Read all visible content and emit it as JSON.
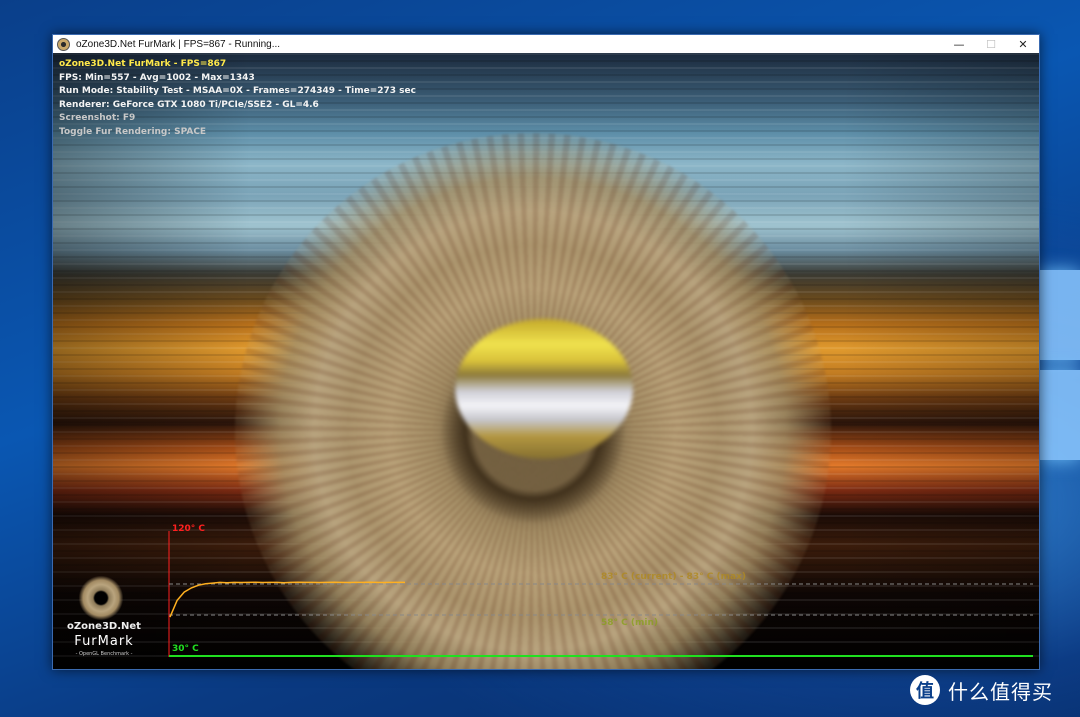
{
  "window": {
    "title": "oZone3D.Net FurMark | FPS=867 - Running...",
    "controls": {
      "minimize": "—",
      "maximize": "☐",
      "close": "✕"
    }
  },
  "osd": {
    "line1": "oZone3D.Net FurMark - FPS=867",
    "line2": "FPS: Min=557 - Avg=1002 - Max=1343",
    "line3": "Run Mode: Stability Test - MSAA=0X - Frames=274349 - Time=273 sec",
    "line4": "Renderer: GeForce GTX 1080 Ti/PCIe/SSE2 - GL=4.6",
    "line5": "Screenshot: F9",
    "line6": "Toggle Fur Rendering: SPACE"
  },
  "logo": {
    "site": "oZone3D.Net",
    "product": "FurMark",
    "tagline": "- OpenGL Benchmark -"
  },
  "temperature_graph": {
    "top_label": "120° C",
    "bottom_label": "30° C",
    "cur_label": "83° C (current) - 83° C (max)",
    "mid_label": "58° C (min)",
    "colors": {
      "axis_top": "#ff2020",
      "axis_bottom": "#20e020",
      "curve": "#ffb020",
      "dashed": "#888888"
    }
  },
  "chart_data": {
    "type": "line",
    "ylim": [
      30,
      120
    ],
    "series": [
      {
        "values": [
          58,
          70,
          76,
          79,
          81,
          82,
          82.5,
          83,
          82.8,
          83,
          82.9,
          83,
          83.1,
          82.9,
          83,
          83,
          82.8,
          83,
          83.1,
          83,
          83,
          82.9,
          83,
          83.1,
          83,
          82.9,
          83,
          83,
          83.1,
          83,
          82.9,
          83,
          83,
          83
        ]
      }
    ]
  },
  "watermark": {
    "text": "什么值得买",
    "icon": "zhi-icon"
  }
}
